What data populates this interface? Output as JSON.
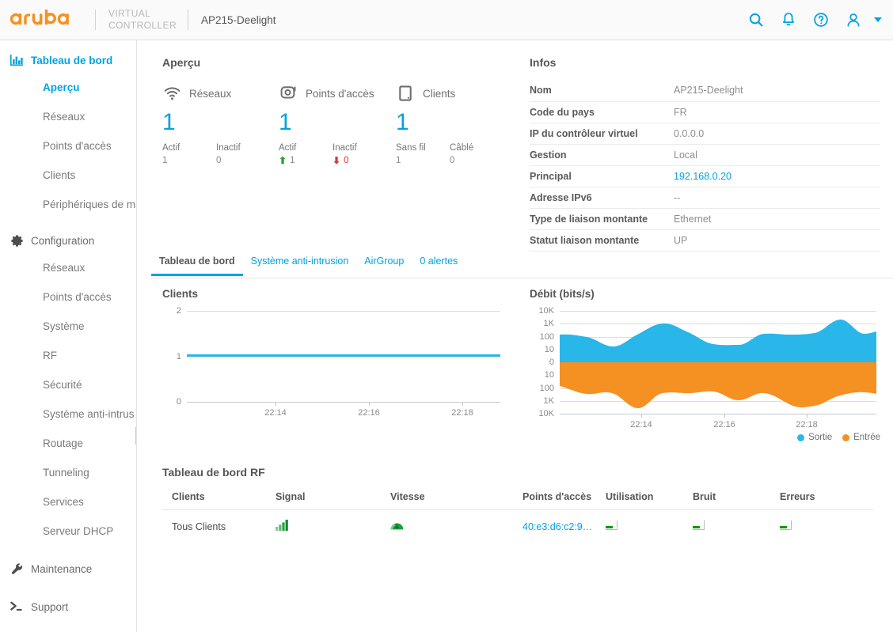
{
  "header": {
    "logo_text": "aruba",
    "virtual_controller_line1": "VIRTUAL",
    "virtual_controller_line2": "CONTROLLER",
    "device_name": "AP215-Deelight",
    "icons": {
      "search": "search-icon",
      "alerts": "bell-icon",
      "help": "help-icon",
      "user": "user-icon",
      "caret": "chevron-down-icon"
    }
  },
  "sidebar": {
    "groups": [
      {
        "label": "Tableau de bord",
        "icon": "bar-chart-icon",
        "active": true,
        "items": [
          {
            "label": "Aperçu",
            "active": true
          },
          {
            "label": "Réseaux",
            "active": false
          },
          {
            "label": "Points d'accès",
            "active": false
          },
          {
            "label": "Clients",
            "active": false
          },
          {
            "label": "Périphériques de m",
            "active": false
          }
        ]
      },
      {
        "label": "Configuration",
        "icon": "gear-icon",
        "active": false,
        "items": [
          {
            "label": "Réseaux",
            "active": false
          },
          {
            "label": "Points d'accès",
            "active": false
          },
          {
            "label": "Système",
            "active": false
          },
          {
            "label": "RF",
            "active": false
          },
          {
            "label": "Sécurité",
            "active": false
          },
          {
            "label": "Système anti-intrus",
            "active": false
          },
          {
            "label": "Routage",
            "active": false
          },
          {
            "label": "Tunneling",
            "active": false
          },
          {
            "label": "Services",
            "active": false
          },
          {
            "label": "Serveur DHCP",
            "active": false
          }
        ]
      },
      {
        "label": "Maintenance",
        "icon": "wrench-icon",
        "active": false,
        "items": []
      },
      {
        "label": "Support",
        "icon": "terminal-icon",
        "active": false,
        "items": []
      }
    ]
  },
  "overview": {
    "title": "Aperçu",
    "cards": [
      {
        "label": "Réseaux",
        "icon": "wifi-icon",
        "count": "1",
        "stats": [
          {
            "label": "Actif",
            "value": "1",
            "arrow": "none"
          },
          {
            "label": "Inactif",
            "value": "0",
            "arrow": "none"
          }
        ]
      },
      {
        "label": "Points d'accès",
        "icon": "access-point-icon",
        "count": "1",
        "stats": [
          {
            "label": "Actif",
            "value": "1",
            "arrow": "up"
          },
          {
            "label": "Inactif",
            "value": "0",
            "arrow": "down"
          }
        ]
      },
      {
        "label": "Clients",
        "icon": "tablet-icon",
        "count": "1",
        "stats": [
          {
            "label": "Sans fil",
            "value": "1",
            "arrow": "none"
          },
          {
            "label": "Câblé",
            "value": "0",
            "arrow": "none"
          }
        ]
      }
    ]
  },
  "infos": {
    "title": "Infos",
    "rows": [
      {
        "key": "Nom",
        "value": "AP215-Deelight",
        "link": false
      },
      {
        "key": "Code du pays",
        "value": "FR",
        "link": false
      },
      {
        "key": "IP du contrôleur virtuel",
        "value": "0.0.0.0",
        "link": false
      },
      {
        "key": "Gestion",
        "value": "Local",
        "link": false
      },
      {
        "key": "Principal",
        "value": "192.168.0.20",
        "link": true
      },
      {
        "key": "Adresse IPv6",
        "value": "--",
        "link": false
      },
      {
        "key": "Type de liaison montante",
        "value": "Ethernet",
        "link": false
      },
      {
        "key": "Statut liaison montante",
        "value": "UP",
        "link": false
      }
    ]
  },
  "tabs": [
    {
      "label": "Tableau de bord",
      "active": true
    },
    {
      "label": "Système anti-intrusion",
      "active": false
    },
    {
      "label": "AirGroup",
      "active": false
    },
    {
      "label": "0 alertes",
      "active": false
    }
  ],
  "chart_data": [
    {
      "type": "line",
      "title": "Clients",
      "xlabel": "",
      "ylabel": "",
      "ylim": [
        0,
        2
      ],
      "yticks": [
        "0",
        "1",
        "2"
      ],
      "x": [
        "22:14",
        "22:16",
        "22:18"
      ],
      "xticks": [
        "22:14",
        "22:16",
        "22:18"
      ],
      "grid": true,
      "legend": "none",
      "series": [
        {
          "name": "Clients",
          "color": "#29b6e8",
          "values": [
            1,
            1,
            1,
            1,
            1,
            1,
            1,
            1,
            1,
            1,
            1,
            1,
            1,
            1,
            1,
            1,
            1,
            1,
            1,
            1,
            1
          ]
        }
      ]
    },
    {
      "type": "area",
      "title": "Débit (bits/s)",
      "xlabel": "",
      "ylabel": "bits/s",
      "yticks": [
        "10K",
        "1K",
        "100",
        "10",
        "0",
        "10",
        "100",
        "1K",
        "10K"
      ],
      "xticks": [
        "22:14",
        "22:16",
        "22:18"
      ],
      "grid": true,
      "legend": "bottom-right",
      "scale": "symlog",
      "series": [
        {
          "name": "Sortie",
          "color": "#29b6e8",
          "direction": "up",
          "values": [
            180,
            170,
            150,
            120,
            35,
            30,
            90,
            250,
            600,
            420,
            220,
            90,
            40,
            38,
            40,
            160,
            170,
            150,
            155,
            300,
            800,
            420,
            70,
            90,
            130
          ]
        },
        {
          "name": "Entrée",
          "color": "#f59022",
          "direction": "down",
          "values": [
            45,
            120,
            200,
            190,
            150,
            120,
            300,
            900,
            1000,
            300,
            170,
            210,
            160,
            150,
            140,
            200,
            160,
            400,
            250,
            150,
            300,
            700,
            800,
            400,
            200
          ]
        }
      ]
    }
  ],
  "rf_dashboard": {
    "title": "Tableau de bord RF",
    "clients_table": {
      "columns": [
        "Clients",
        "Signal",
        "Vitesse"
      ],
      "rows": [
        {
          "client": "Tous Clients",
          "signal_icon": "signal-bars-icon",
          "speed_icon": "gauge-icon"
        }
      ]
    },
    "ap_table": {
      "columns": [
        "Points d'accès",
        "Utilisation",
        "Bruit",
        "Erreurs"
      ],
      "rows": [
        {
          "ap": "40:e3:d6:c2:9…",
          "utilisation_icon": "mini-bar-chart-icon",
          "bruit_icon": "mini-bar-chart-icon",
          "erreurs_icon": "mini-bar-chart-icon"
        }
      ]
    }
  },
  "colors": {
    "brand_orange": "#f7901e",
    "accent_blue": "#00a2e1",
    "chart_blue": "#29b6e8",
    "chart_orange": "#f59022",
    "status_green": "#22a02a",
    "status_red": "#e03434"
  }
}
